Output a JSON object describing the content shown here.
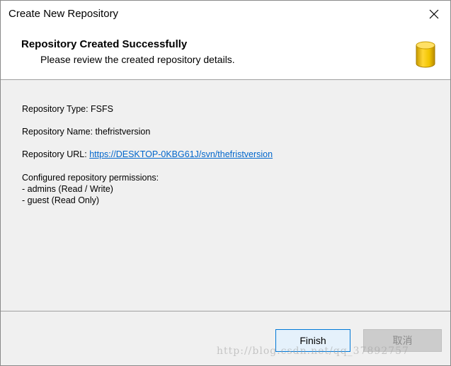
{
  "window": {
    "title": "Create New Repository",
    "close_glyph": "✕"
  },
  "header": {
    "title": "Repository Created Successfully",
    "subtitle": "Please review the created repository details.",
    "icon": "database-icon"
  },
  "details": {
    "type_label": "Repository Type: ",
    "type_value": "FSFS",
    "name_label": "Repository Name: ",
    "name_value": "thefristversion",
    "url_label": "Repository URL: ",
    "url_value": "https://DESKTOP-0KBG61J/svn/thefristversion",
    "permissions_heading": "Configured repository permissions:",
    "permissions": [
      "- admins (Read / Write)",
      "- guest (Read Only)"
    ]
  },
  "buttons": {
    "finish": "Finish",
    "cancel": "取消"
  },
  "watermark": "http://blog.csdn.net/qq_37892757",
  "colors": {
    "link": "#0066cc",
    "accent": "#0078d7",
    "icon_gold": "#f2c500"
  }
}
